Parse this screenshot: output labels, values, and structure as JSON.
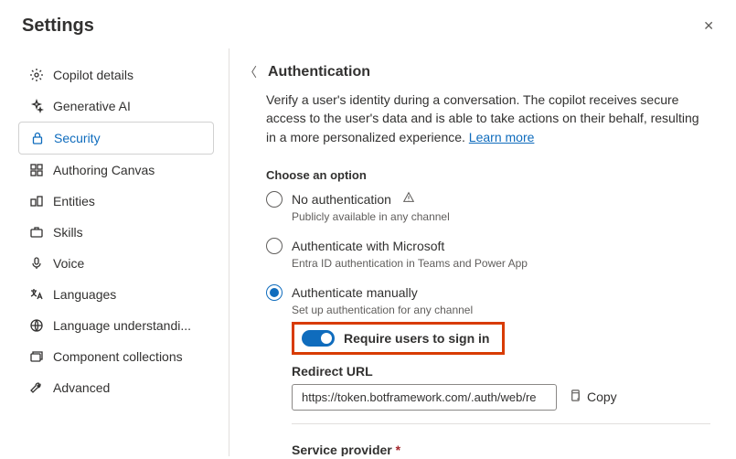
{
  "header": {
    "title": "Settings"
  },
  "sidebar": {
    "items": [
      {
        "label": "Copilot details"
      },
      {
        "label": "Generative AI"
      },
      {
        "label": "Security"
      },
      {
        "label": "Authoring Canvas"
      },
      {
        "label": "Entities"
      },
      {
        "label": "Skills"
      },
      {
        "label": "Voice"
      },
      {
        "label": "Languages"
      },
      {
        "label": "Language understandi..."
      },
      {
        "label": "Component collections"
      },
      {
        "label": "Advanced"
      }
    ]
  },
  "main": {
    "title": "Authentication",
    "description": "Verify a user's identity during a conversation. The copilot receives secure access to the user's data and is able to take actions on their behalf, resulting in a more personalized experience. ",
    "learn_more": "Learn more",
    "choose_label": "Choose an option",
    "options": [
      {
        "label": "No authentication",
        "sub": "Publicly available in any channel"
      },
      {
        "label": "Authenticate with Microsoft",
        "sub": "Entra ID authentication in Teams and Power App"
      },
      {
        "label": "Authenticate manually",
        "sub": "Set up authentication for any channel"
      }
    ],
    "toggle_label": "Require users to sign in",
    "redirect_label": "Redirect URL",
    "redirect_value": "https://token.botframework.com/.auth/web/re",
    "copy_label": "Copy",
    "service_provider_label": "Service provider"
  }
}
